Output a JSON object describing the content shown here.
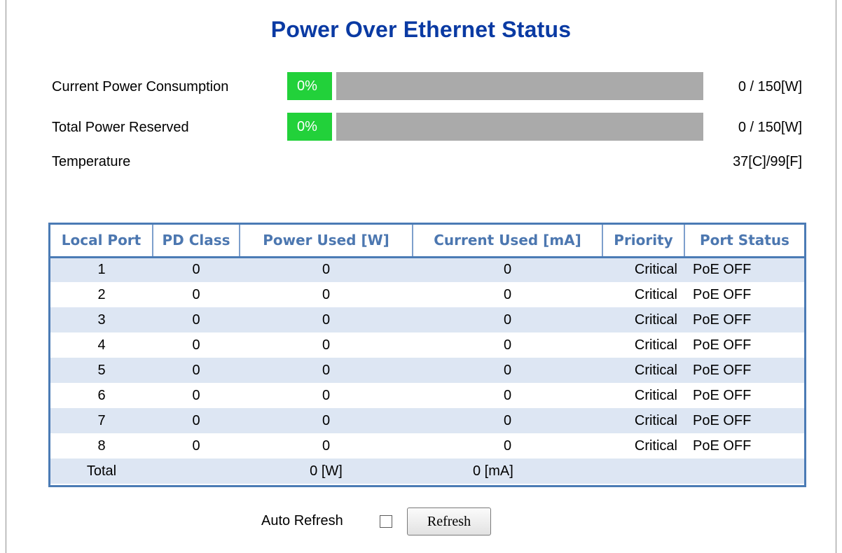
{
  "page": {
    "title": "Power Over Ethernet Status"
  },
  "stats": {
    "consumption": {
      "label": "Current Power Consumption",
      "percent_text": "0%",
      "percent": 0,
      "value": "0 / 150[W]"
    },
    "reserved": {
      "label": "Total Power Reserved",
      "percent_text": "0%",
      "percent": 0,
      "value": "0 / 150[W]"
    },
    "temperature": {
      "label": "Temperature",
      "value": "37[C]/99[F]"
    }
  },
  "colors": {
    "title": "#0a3aa3",
    "bar_fill": "#22d13a",
    "bar_track": "#aaaaaa",
    "table_border": "#4b7bb5",
    "table_header_text": "#4c77b0",
    "row_stripe": "#dde6f3"
  },
  "table": {
    "headers": [
      "Local Port",
      "PD Class",
      "Power Used [W]",
      "Current Used [mA]",
      "Priority",
      "Port Status"
    ],
    "rows": [
      [
        "1",
        "0",
        "0",
        "0",
        "Critical",
        "PoE OFF"
      ],
      [
        "2",
        "0",
        "0",
        "0",
        "Critical",
        "PoE OFF"
      ],
      [
        "3",
        "0",
        "0",
        "0",
        "Critical",
        "PoE OFF"
      ],
      [
        "4",
        "0",
        "0",
        "0",
        "Critical",
        "PoE OFF"
      ],
      [
        "5",
        "0",
        "0",
        "0",
        "Critical",
        "PoE OFF"
      ],
      [
        "6",
        "0",
        "0",
        "0",
        "Critical",
        "PoE OFF"
      ],
      [
        "7",
        "0",
        "0",
        "0",
        "Critical",
        "PoE OFF"
      ],
      [
        "8",
        "0",
        "0",
        "0",
        "Critical",
        "PoE OFF"
      ]
    ],
    "total": {
      "label": "Total",
      "power": "0 [W]",
      "current": "0 [mA]"
    }
  },
  "controls": {
    "auto_refresh_label": "Auto Refresh",
    "auto_refresh_checked": false,
    "refresh_button": "Refresh"
  }
}
